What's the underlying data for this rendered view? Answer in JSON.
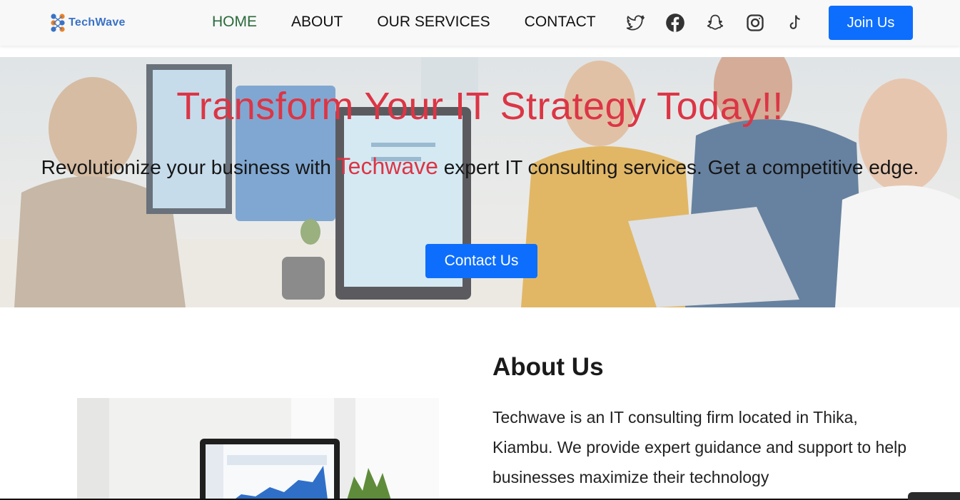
{
  "brand": {
    "name": "TechWave",
    "color": "#3a72c6"
  },
  "nav": {
    "links": [
      "HOME",
      "ABOUT",
      "OUR SERVICES",
      "CONTACT"
    ],
    "active_index": 0,
    "active_color": "#2a6a3a",
    "socials": [
      "twitter-icon",
      "facebook-icon",
      "snapchat-icon",
      "instagram-icon",
      "tiktok-icon"
    ],
    "join_label": "Join Us"
  },
  "hero": {
    "title": "Transform Your IT Strategy Today!!",
    "subtitle_before": "Revolutionize your business with ",
    "subtitle_brand": "Techwave",
    "subtitle_after": " expert IT consulting services. Get a competitive edge.",
    "cta_label": "Contact Us",
    "accent_color": "#dc3545"
  },
  "about": {
    "heading": "About Us",
    "text": "Techwave is an IT consulting firm located in Thika, Kiambu. We provide expert guidance and support to help businesses maximize their technology"
  },
  "colors": {
    "primary": "#0d6efd",
    "accent": "#dc3545"
  }
}
